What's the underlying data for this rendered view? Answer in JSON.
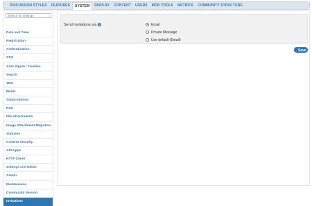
{
  "tabs": [
    {
      "label": "DISCUSSION STYLES"
    },
    {
      "label": "FEATURES"
    },
    {
      "label": "SYSTEM"
    },
    {
      "label": "DISPLAY"
    },
    {
      "label": "CONTENT"
    },
    {
      "label": "USERS"
    },
    {
      "label": "MOD TOOLS"
    },
    {
      "label": "METRICS"
    },
    {
      "label": "COMMUNITY STRUCTURE"
    }
  ],
  "active_tab": "SYSTEM",
  "sidebar": {
    "search_placeholder": "Search for settings",
    "items": [
      {
        "label": "Date and Time"
      },
      {
        "label": "Registration"
      },
      {
        "label": "Authentication"
      },
      {
        "label": "SSO"
      },
      {
        "label": "Auto Signin / Cookies"
      },
      {
        "label": "Search"
      },
      {
        "label": "SEO"
      },
      {
        "label": "Mailer"
      },
      {
        "label": "Subscriptions"
      },
      {
        "label": "RSS"
      },
      {
        "label": "File Attachments"
      },
      {
        "label": "Image Attachment Migration"
      },
      {
        "label": "Statuses"
      },
      {
        "label": "Content Security"
      },
      {
        "label": "API Apps"
      },
      {
        "label": "HTTP Client"
      },
      {
        "label": "Settings List Editor"
      },
      {
        "label": "Admin"
      },
      {
        "label": "Maintenance"
      },
      {
        "label": "Community Version"
      },
      {
        "label": "Invitations"
      }
    ],
    "active_item": "Invitations"
  },
  "form": {
    "label": "Send invitations via",
    "options": [
      {
        "label": "Email",
        "checked": true
      },
      {
        "label": "Private Message",
        "checked": false
      },
      {
        "label": "Use default (Email)",
        "checked": false
      }
    ],
    "save_label": "Save"
  },
  "colors": {
    "accent": "#2f77b3",
    "tabbar_bg": "#dde6ee",
    "option_bg": "#f1f1f1"
  }
}
